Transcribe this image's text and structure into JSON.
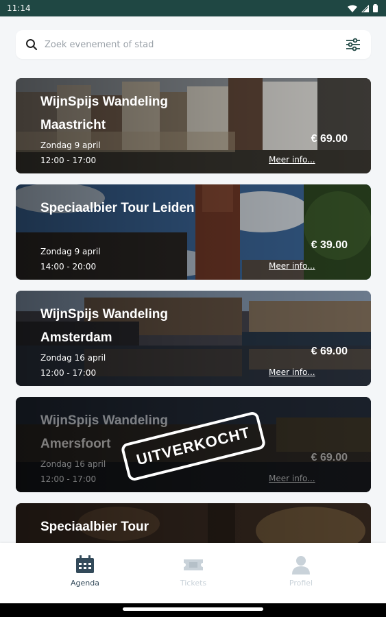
{
  "status_bar": {
    "time": "11:14"
  },
  "search": {
    "placeholder": "Zoek evenement of stad"
  },
  "events": [
    {
      "title": "WijnSpijs Wandeling Maastricht",
      "date": "Zondag 9 april",
      "time": "12:00 - 17:00",
      "price": "€ 69.00",
      "more": "Meer info...",
      "sold_out": false,
      "image": "city-canal-houses"
    },
    {
      "title": "Speciaalbier Tour Leiden",
      "date": "Zondag 9 april",
      "time": "14:00 - 20:00",
      "price": "€ 39.00",
      "more": "Meer info...",
      "sold_out": false,
      "image": "church-tower"
    },
    {
      "title": "WijnSpijs Wandeling Amsterdam",
      "date": "Zondag 16 april",
      "time": "12:00 - 17:00",
      "price": "€ 69.00",
      "more": "Meer info...",
      "sold_out": false,
      "image": "amsterdam-canal"
    },
    {
      "title": "WijnSpijs Wandeling Amersfoort",
      "date": "Zondag 16 april",
      "time": "12:00 - 17:00",
      "price": "€ 69.00",
      "more": "Meer info...",
      "sold_out": true,
      "stamp": "UITVERKOCHT",
      "image": "night-canal"
    },
    {
      "title": "Speciaalbier Tour",
      "image": "beer-tasting"
    }
  ],
  "nav": {
    "items": [
      {
        "label": "Agenda",
        "icon": "calendar-icon",
        "active": true
      },
      {
        "label": "Tickets",
        "icon": "ticket-icon",
        "active": false
      },
      {
        "label": "Profiel",
        "icon": "user-icon",
        "active": false
      }
    ]
  },
  "colors": {
    "status_bar": "#1f4743",
    "active_nav": "#334a5a",
    "inactive_nav": "#c9d2d9",
    "background": "#f4f6f8"
  }
}
